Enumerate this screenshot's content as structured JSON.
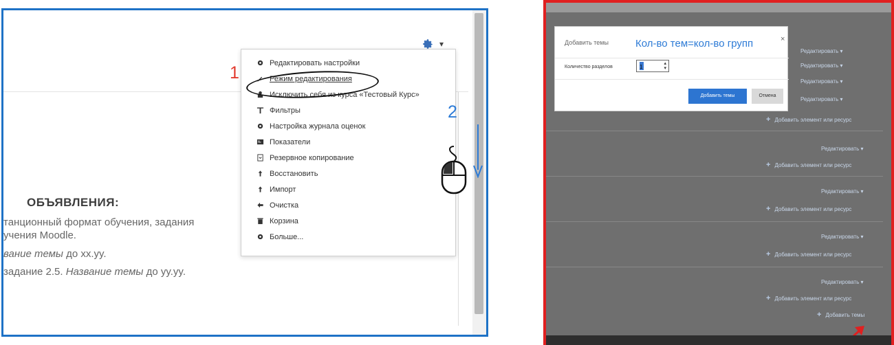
{
  "left": {
    "menu": {
      "items": [
        {
          "label": "Редактировать настройки",
          "icon": "gear-icon"
        },
        {
          "label": "Режим редактирования",
          "icon": "pencil-icon"
        },
        {
          "label": "Исключить себя из курса «Тестовый Курс»",
          "icon": "user-icon"
        },
        {
          "label": "Фильтры",
          "icon": "filter-icon"
        },
        {
          "label": "Настройка журнала оценок",
          "icon": "gear-icon"
        },
        {
          "label": "Показатели",
          "icon": "chart-icon"
        },
        {
          "label": "Резервное копирование",
          "icon": "file-icon"
        },
        {
          "label": "Восстановить",
          "icon": "upload-icon"
        },
        {
          "label": "Импорт",
          "icon": "upload-icon"
        },
        {
          "label": "Очистка",
          "icon": "arrow-left-icon"
        },
        {
          "label": "Корзина",
          "icon": "trash-icon"
        },
        {
          "label": "Больше...",
          "icon": "gear-icon"
        }
      ]
    },
    "announcements": {
      "title": "ОБЪЯВЛЕНИЯ:",
      "line1": "танционный формат обучения, задания",
      "line2": "учения Moodle.",
      "line3_em": "вание темы",
      "line3_rest": " до xx.yy.",
      "line4_pre": " задание 2.5. ",
      "line4_em": "Название темы",
      "line4_rest": " до yy.yy."
    },
    "annotations": {
      "step1": "1",
      "step2": "2"
    }
  },
  "right": {
    "modal": {
      "title": "Добавить темы",
      "note": "Кол-во тем=кол-во групп",
      "close": "×",
      "field_label": "Количество разделов",
      "field_value": "1",
      "add_button": "Добавить темы",
      "cancel_button": "Отмена"
    },
    "edit_label": "Редактировать ▾",
    "add_resource_label": "Добавить элемент или ресурс",
    "add_topics_link": "Добавить темы"
  },
  "colors": {
    "left_border": "#1e72c6",
    "right_border": "#e02020",
    "primary_button": "#2d75d1",
    "annotation_red": "#e23a2e",
    "annotation_blue": "#2d7bd6"
  }
}
